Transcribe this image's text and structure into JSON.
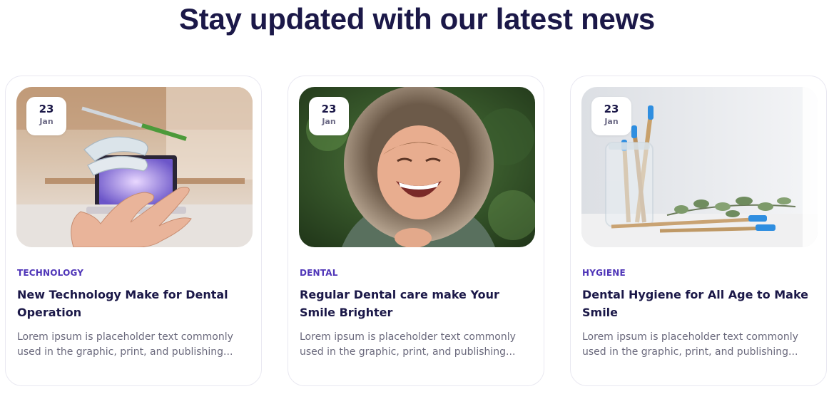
{
  "section": {
    "title": "Stay updated with our latest news"
  },
  "posts": [
    {
      "day": "23",
      "month": "Jan",
      "category": "TECHNOLOGY",
      "title": "New Technology Make for Dental Operation",
      "excerpt": "Lorem ipsum is placeholder text commonly used in the graphic, print, and publishing...",
      "image": "floating-dental-aligner-hand-photo"
    },
    {
      "day": "23",
      "month": "Jan",
      "category": "DENTAL",
      "title": "Regular Dental care make Your Smile Brighter",
      "excerpt": "Lorem ipsum is placeholder text commonly used in the graphic, print, and publishing...",
      "image": "laughing-child-fur-hood-photo"
    },
    {
      "day": "23",
      "month": "Jan",
      "category": "HYGIENE",
      "title": "Dental Hygiene for All Age to Make Smile",
      "excerpt": "Lorem ipsum is placeholder text commonly used in the graphic, print, and publishing...",
      "image": "bamboo-toothbrushes-jar-photo"
    }
  ],
  "colors": {
    "heading": "#1b1848",
    "category": "#4f35b8",
    "body_text": "#6b6a7d",
    "card_border": "#e9e8f1"
  }
}
